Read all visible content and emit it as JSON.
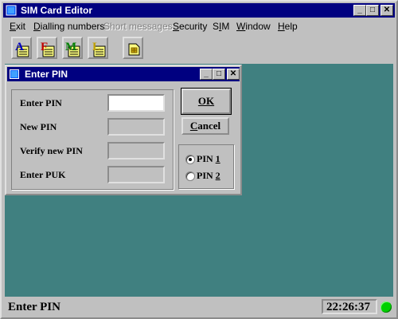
{
  "window": {
    "title": "SIM Card Editor",
    "controls": {
      "minimize": "_",
      "maximize": "□",
      "close": "✕"
    }
  },
  "menu": [
    {
      "id": "exit",
      "label": "Exit",
      "hotkey_index": 0,
      "enabled": true
    },
    {
      "id": "dialling-numbers",
      "label": "Dialling numbers",
      "hotkey_index": 0,
      "enabled": true
    },
    {
      "id": "short-messages",
      "label": "Short messages",
      "hotkey_index": 0,
      "enabled": false
    },
    {
      "id": "security",
      "label": "Security",
      "hotkey_index": 0,
      "enabled": true
    },
    {
      "id": "sim",
      "label": "SIM",
      "hotkey_index": 1,
      "enabled": true
    },
    {
      "id": "window",
      "label": "Window",
      "hotkey_index": 0,
      "enabled": true
    },
    {
      "id": "help",
      "label": "Help",
      "hotkey_index": 0,
      "enabled": true
    }
  ],
  "toolbar": [
    {
      "id": "address-book",
      "icon": "address-book-icon",
      "letter": "A",
      "color": "#0000c0"
    },
    {
      "id": "fixed-dialling",
      "icon": "fixed-dialling-icon",
      "letter": "F",
      "color": "#c00000"
    },
    {
      "id": "messages",
      "icon": "messages-icon",
      "letter": "M",
      "color": "#008000"
    },
    {
      "id": "last-numbers",
      "icon": "last-numbers-icon",
      "letter": "L",
      "color": "#c0a000"
    },
    {
      "id": "sim-card",
      "icon": "sim-card-icon",
      "letter": "",
      "color": "#c0a000"
    }
  ],
  "dialog": {
    "title": "Enter PIN",
    "controls": {
      "minimize": "_",
      "maximize": "□",
      "close": "✕"
    },
    "fields": [
      {
        "id": "enter-pin",
        "label": "Enter PIN",
        "value": "",
        "enabled": true
      },
      {
        "id": "new-pin",
        "label": "New PIN",
        "value": "",
        "enabled": false
      },
      {
        "id": "verify-new-pin",
        "label": "Verify new PIN",
        "value": "",
        "enabled": false
      },
      {
        "id": "enter-puk",
        "label": "Enter PUK",
        "value": "",
        "enabled": false
      }
    ],
    "ok_label": "OK",
    "cancel_label": "Cancel",
    "pin_options": [
      {
        "id": "pin1",
        "label": "PIN 1",
        "selected": true
      },
      {
        "id": "pin2",
        "label": "PIN 2",
        "selected": false
      }
    ]
  },
  "status": {
    "text": "Enter PIN",
    "clock": "22:26:37",
    "indicator_color": "#00d000"
  },
  "colors": {
    "workspace": "#408080",
    "titlebar": "#000080",
    "face": "#c0c0c0"
  }
}
